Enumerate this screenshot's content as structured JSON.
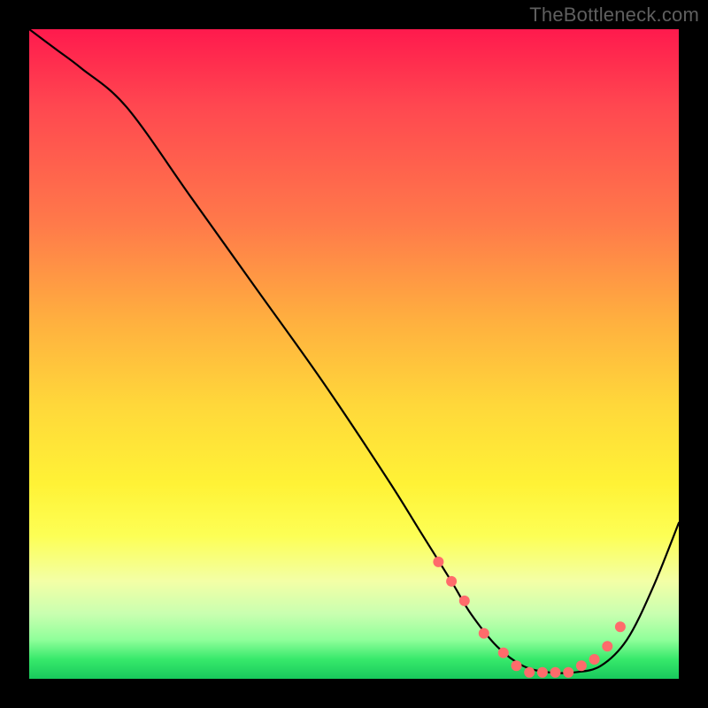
{
  "watermark": "TheBottleneck.com",
  "chart_data": {
    "type": "line",
    "title": "",
    "xlabel": "",
    "ylabel": "",
    "xlim": [
      0,
      100
    ],
    "ylim": [
      0,
      100
    ],
    "series": [
      {
        "name": "bottleneck-curve",
        "x": [
          0,
          4,
          8,
          15,
          25,
          35,
          45,
          55,
          60,
          65,
          68,
          72,
          76,
          80,
          84,
          88,
          92,
          96,
          100
        ],
        "y": [
          100,
          97,
          94,
          88,
          74,
          60,
          46,
          31,
          23,
          15,
          10,
          5,
          2,
          1,
          1,
          2,
          6,
          14,
          24
        ]
      }
    ],
    "markers": {
      "name": "highlight-dots",
      "color": "#ff6b6b",
      "x": [
        63,
        65,
        67,
        70,
        73,
        75,
        77,
        79,
        81,
        83,
        85,
        87,
        89,
        91
      ],
      "y": [
        18,
        15,
        12,
        7,
        4,
        2,
        1,
        1,
        1,
        1,
        2,
        3,
        5,
        8
      ]
    }
  }
}
